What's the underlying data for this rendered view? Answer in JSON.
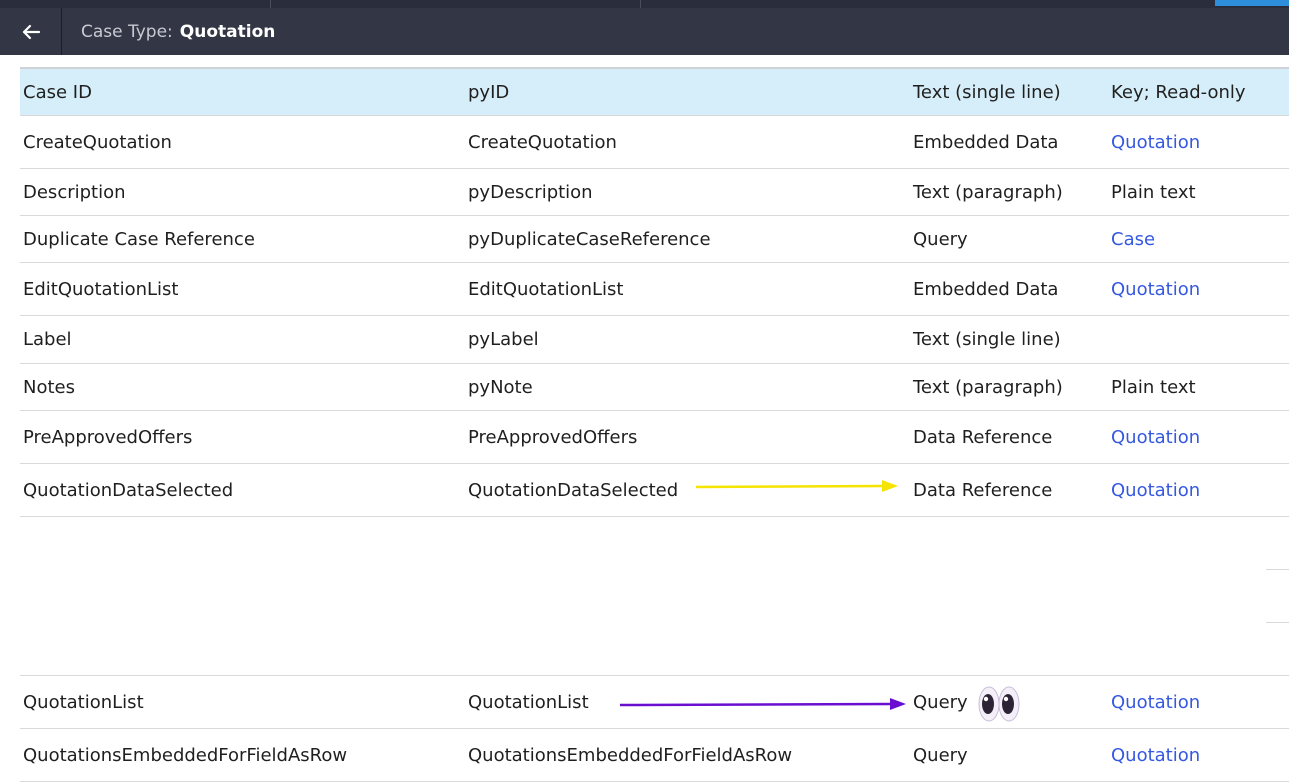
{
  "header": {
    "back_icon": "arrow-left-icon",
    "case_type_label": "Case Type:",
    "case_type_value": "Quotation"
  },
  "table": {
    "header_row": [
      "Case ID",
      "pyID",
      "Text (single line)",
      "Key; Read-only"
    ],
    "rows_top": [
      {
        "name": "CreateQuotation",
        "id": "CreateQuotation",
        "type": "Embedded Data",
        "extra": "Quotation",
        "extra_link": true
      },
      {
        "name": "Description",
        "id": "pyDescription",
        "type": "Text (paragraph)",
        "extra": "Plain text",
        "extra_link": false
      },
      {
        "name": "Duplicate Case Reference",
        "id": "pyDuplicateCaseReference",
        "type": "Query",
        "extra": "Case",
        "extra_link": true
      },
      {
        "name": "EditQuotationList",
        "id": "EditQuotationList",
        "type": "Embedded Data",
        "extra": "Quotation",
        "extra_link": true
      },
      {
        "name": "Label",
        "id": "pyLabel",
        "type": "Text (single line)",
        "extra": "",
        "extra_link": false
      },
      {
        "name": "Notes",
        "id": "pyNote",
        "type": "Text (paragraph)",
        "extra": "Plain text",
        "extra_link": false
      },
      {
        "name": "PreApprovedOffers",
        "id": "PreApprovedOffers",
        "type": "Data Reference",
        "extra": "Quotation",
        "extra_link": true
      },
      {
        "name": "QuotationDataSelected",
        "id": "QuotationDataSelected",
        "type": "Data Reference",
        "extra": "Quotation",
        "extra_link": true
      }
    ],
    "rows_bottom": [
      {
        "name": "QuotationList",
        "id": "QuotationList",
        "type": "Query",
        "extra": "Quotation",
        "extra_link": true
      },
      {
        "name": "QuotationsEmbeddedForFieldAsRow",
        "id": "QuotationsEmbeddedForFieldAsRow",
        "type": "Query",
        "extra": "Quotation",
        "extra_link": true
      }
    ]
  },
  "annotations": {
    "yellow_arrow_color": "#f5e400",
    "purple_arrow_color": "#6a0fd0",
    "eyes_icon": "eyes-emoji-icon"
  },
  "colors": {
    "header_bg": "#333645",
    "table_header_bg": "#d6eef9",
    "link": "#3558e0"
  }
}
